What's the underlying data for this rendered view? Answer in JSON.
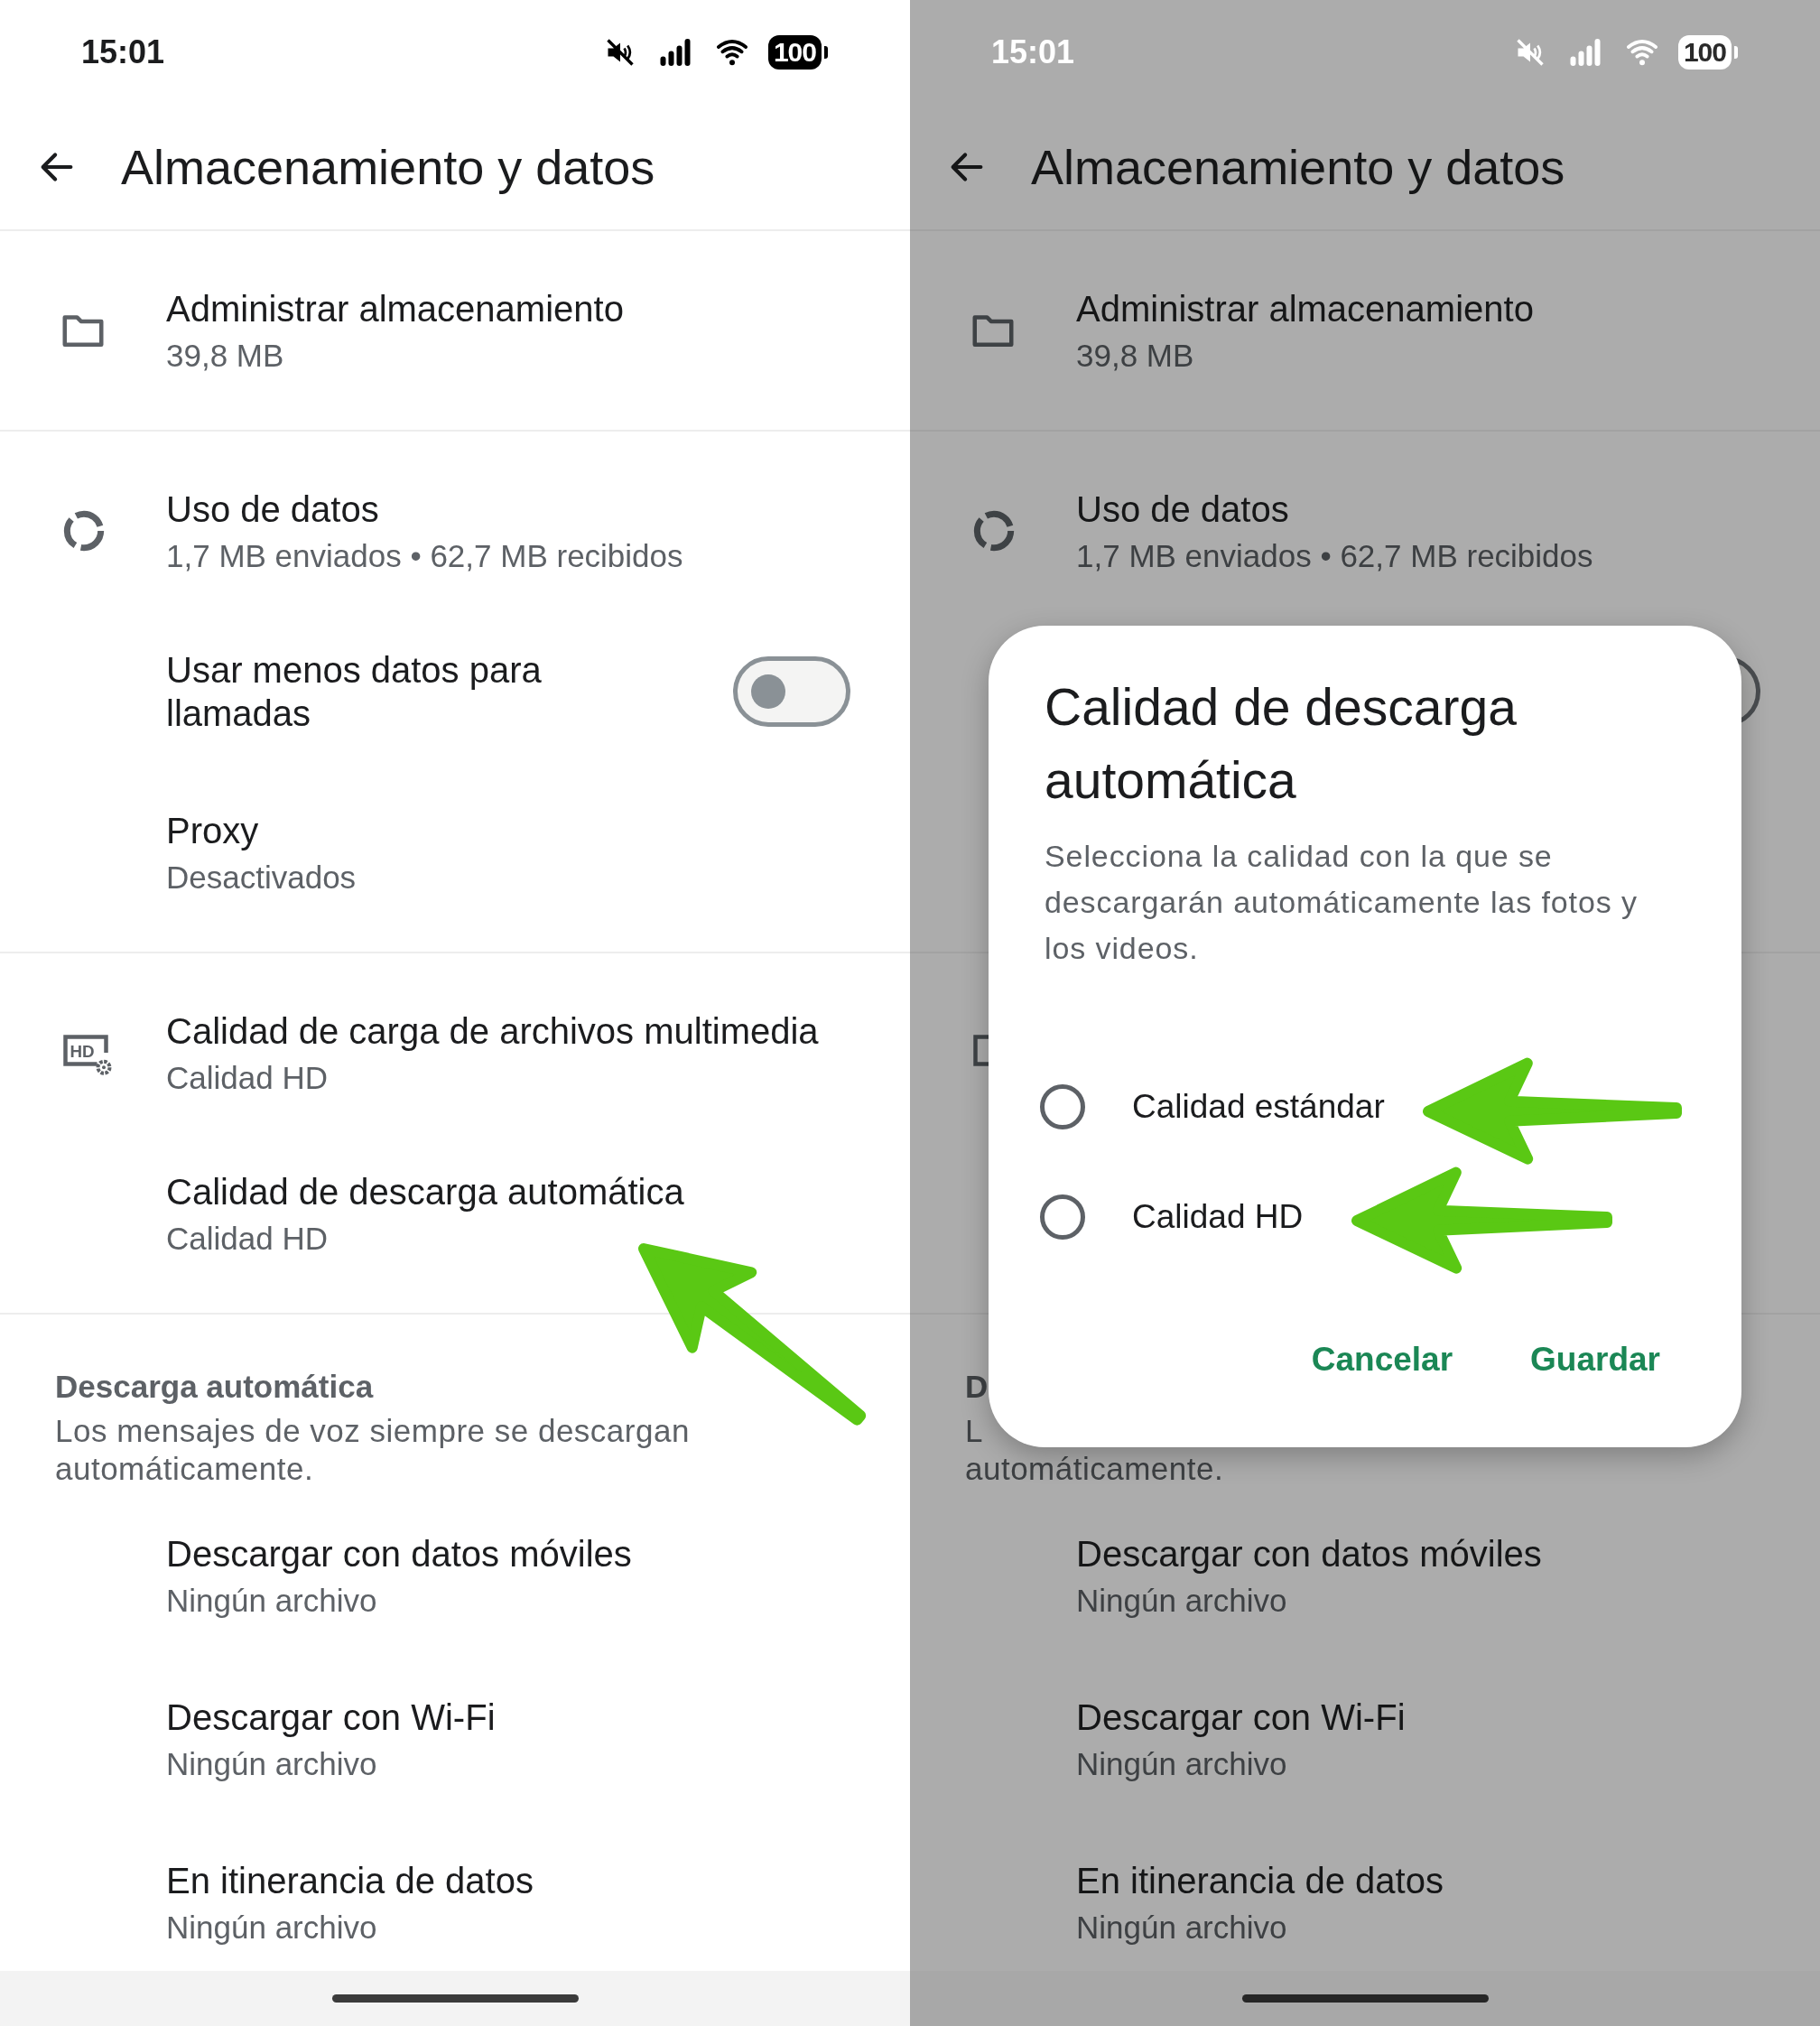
{
  "screens": [
    {
      "dimmed": false,
      "status_bar": {
        "time": "15:01",
        "battery": "100"
      },
      "header": {
        "title": "Almacenamiento y datos"
      },
      "groups": [
        {
          "items": [
            {
              "kind": "nav",
              "title": "Administrar almacenamiento",
              "subtitle": "39,8 MB"
            }
          ]
        },
        {
          "items": [
            {
              "kind": "nav",
              "title": "Uso de datos",
              "subtitle": "1,7 MB enviados • 62,7 MB recibidos"
            },
            {
              "kind": "toggle",
              "title": "Usar menos datos para llamadas",
              "checked": false
            },
            {
              "kind": "nav",
              "title": "Proxy",
              "subtitle": "Desactivados"
            }
          ]
        },
        {
          "items": [
            {
              "kind": "nav",
              "title": "Calidad de carga de archivos multimedia",
              "subtitle": "Calidad HD",
              "icon_label": "HD"
            },
            {
              "kind": "nav",
              "title": "Calidad de descarga automática",
              "subtitle": "Calidad HD"
            }
          ]
        },
        {
          "header": "Descarga automática",
          "description": "Los mensajes de voz siempre se descargan automáticamente.",
          "items": [
            {
              "kind": "nav",
              "title": "Descargar con datos móviles",
              "subtitle": "Ningún archivo"
            },
            {
              "kind": "nav",
              "title": "Descargar con Wi-Fi",
              "subtitle": "Ningún archivo"
            },
            {
              "kind": "nav",
              "title": "En itinerancia de datos",
              "subtitle": "Ningún archivo"
            }
          ]
        }
      ]
    },
    {
      "dimmed": true,
      "status_bar": {
        "time": "15:01",
        "battery": "100"
      },
      "header": {
        "title": "Almacenamiento y datos"
      },
      "groups": [
        {
          "items": [
            {
              "kind": "nav",
              "title": "Administrar almacenamiento",
              "subtitle": "39,8 MB"
            }
          ]
        },
        {
          "items": [
            {
              "kind": "nav",
              "title": "Uso de datos",
              "subtitle": "1,7 MB enviados • 62,7 MB recibidos"
            },
            {
              "kind": "toggle",
              "checked": false
            },
            {
              "kind": "covered"
            }
          ]
        },
        {
          "items": [
            {
              "kind": "nav"
            },
            {
              "kind": "covered"
            }
          ]
        },
        {
          "header": "D",
          "description_lines": [
            "L",
            "automáticamente."
          ],
          "items": [
            {
              "kind": "nav",
              "title": "Descargar con datos móviles",
              "subtitle": "Ningún archivo"
            },
            {
              "kind": "nav",
              "title": "Descargar con Wi-Fi",
              "subtitle": "Ningún archivo"
            },
            {
              "kind": "nav",
              "title": "En itinerancia de datos",
              "subtitle": "Ningún archivo"
            }
          ]
        }
      ],
      "dialog": {
        "title": "Calidad de descarga automática",
        "body": "Selecciona la calidad con la que se descargarán automáticamente las fotos y los videos.",
        "options": [
          {
            "label": "Calidad estándar",
            "selected": false
          },
          {
            "label": "Calidad HD",
            "selected": false
          }
        ],
        "buttons": [
          "Cancelar",
          "Guardar"
        ]
      }
    }
  ]
}
